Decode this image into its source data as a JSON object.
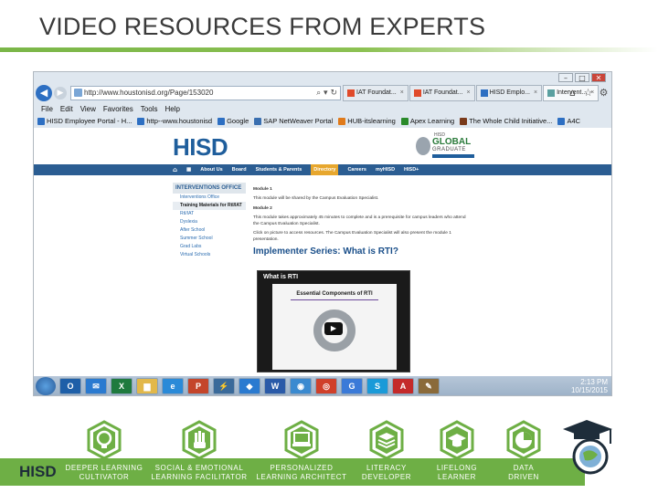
{
  "slide": {
    "title": "VIDEO RESOURCES FROM EXPERTS"
  },
  "browser": {
    "url": "http://www.houstonisd.org/Page/153020",
    "tabs": [
      {
        "label": "IAT Foundat...",
        "active": false
      },
      {
        "label": "IAT Foundat...",
        "active": false
      },
      {
        "label": "HISD Emplo...",
        "active": false
      },
      {
        "label": "Intervent...",
        "active": true
      }
    ],
    "menu": [
      "File",
      "Edit",
      "View",
      "Favorites",
      "Tools",
      "Help"
    ],
    "favorites": [
      {
        "label": "HISD Employee Portal - H...",
        "color": "#2d6fc2"
      },
      {
        "label": "http--www.houstonisd",
        "color": "#2d6fc2"
      },
      {
        "label": "Google",
        "color": "#2d6fc2"
      },
      {
        "label": "SAP NetWeaver Portal",
        "color": "#3a6fb0"
      },
      {
        "label": "HUB-itslearning",
        "color": "#e07a1a"
      },
      {
        "label": "Apex Learning",
        "color": "#2a8a2a"
      },
      {
        "label": "The Whole Child Initiative...",
        "color": "#7a3a1a"
      },
      {
        "label": "A4C",
        "color": "#2d6fc2"
      }
    ]
  },
  "site": {
    "logo": "HISD",
    "badge": {
      "top": "HISD",
      "big": "GLOBAL",
      "sub": "GRADUATE"
    },
    "nav": [
      "About Us",
      "Board",
      "Students & Parents",
      "Directory",
      "Careers",
      "myHISD",
      "HISD+"
    ],
    "nav_active": "Directory",
    "sidebar": {
      "heading": "INTERVENTIONS OFFICE",
      "items": [
        {
          "label": "Interventions Office",
          "style": "link"
        },
        {
          "label": "Training Materials for RtI/IAT",
          "style": "bold"
        },
        {
          "label": "RtI/IAT",
          "style": "link"
        },
        {
          "label": "Dyslexia",
          "style": "link"
        },
        {
          "label": "After School",
          "style": "link"
        },
        {
          "label": "Summer School",
          "style": "link"
        },
        {
          "label": "Grad Labs",
          "style": "link"
        },
        {
          "label": "Virtual Schools",
          "style": "link"
        }
      ]
    },
    "content": {
      "module1_heading": "Module 1",
      "module1_text": "This module will be shared by the Campus Evaluation Specialist.",
      "module2_heading": "Module 2",
      "module2_text": "This module takes approximately 45 minutes to complete and is a prerequisite for campus leaders who attend the Campus Evaluation Specialist.",
      "click_text": "Click on picture to access resources. The Campus Evaluation Specialist will also present the module 1 presentation.",
      "series_title": "Implementer Series: What is RTI?",
      "video_caption": "What is RTI",
      "video_heading": "Essential Components of RTI"
    }
  },
  "taskbar": {
    "icons": [
      {
        "name": "outlook",
        "label": "O",
        "color": "#1e5fa8"
      },
      {
        "name": "mail",
        "label": "✉",
        "color": "#2a7ad0"
      },
      {
        "name": "excel",
        "label": "X",
        "color": "#1f7a3e"
      },
      {
        "name": "folder",
        "label": "▆",
        "color": "#e2b84a"
      },
      {
        "name": "ie",
        "label": "e",
        "color": "#2a8ad8"
      },
      {
        "name": "powerpoint",
        "label": "P",
        "color": "#c4452a"
      },
      {
        "name": "network",
        "label": "⚡",
        "color": "#3a6a9a"
      },
      {
        "name": "dropbox",
        "label": "◆",
        "color": "#2a7ad0"
      },
      {
        "name": "word",
        "label": "W",
        "color": "#2a5aa8"
      },
      {
        "name": "globe",
        "label": "◉",
        "color": "#3a8ad0"
      },
      {
        "name": "chrome",
        "label": "◎",
        "color": "#d0402a"
      },
      {
        "name": "google",
        "label": "G",
        "color": "#3a7ad8"
      },
      {
        "name": "skype",
        "label": "S",
        "color": "#1a9ad8"
      },
      {
        "name": "acrobat",
        "label": "A",
        "color": "#c42a2a"
      },
      {
        "name": "paint",
        "label": "✎",
        "color": "#8a6a3a"
      }
    ],
    "time": "2:13 PM",
    "date": "10/15/2015"
  },
  "footer": {
    "logo": "HISD",
    "pillars": [
      {
        "line1": "DEEPER LEARNING",
        "line2": "CULTIVATOR",
        "icon": "lightbulb-icon"
      },
      {
        "line1": "SOCIAL & EMOTIONAL",
        "line2": "LEARNING FACILITATOR",
        "icon": "hand-icon"
      },
      {
        "line1": "PERSONALIZED",
        "line2": "LEARNING ARCHITECT",
        "icon": "laptop-icon"
      },
      {
        "line1": "LITERACY",
        "line2": "DEVELOPER",
        "icon": "book-icon"
      },
      {
        "line1": "LIFELONG",
        "line2": "LEARNER",
        "icon": "mortarboard-icon"
      },
      {
        "line1": "DATA",
        "line2": "DRIVEN",
        "icon": "pie-chart-icon"
      }
    ],
    "accent": "#6eaf45"
  }
}
